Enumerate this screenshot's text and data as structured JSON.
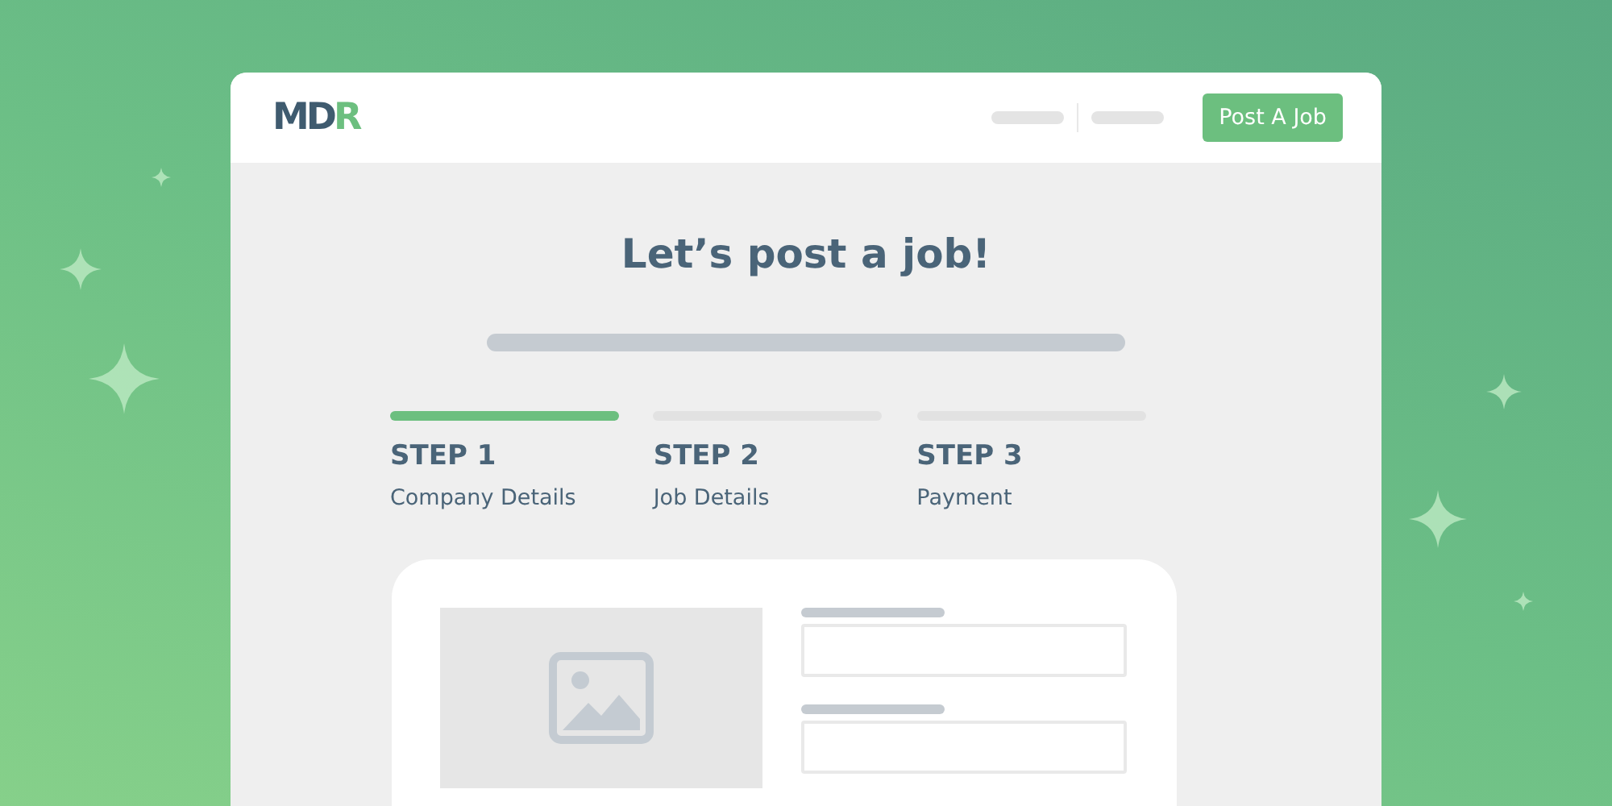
{
  "logo": {
    "text": "MD",
    "accent": "R"
  },
  "header": {
    "button": "Post A Job"
  },
  "title": "Let’s post a job!",
  "steps": [
    {
      "label": "STEP 1",
      "name": "Company Details",
      "selected": true
    },
    {
      "label": "STEP 2",
      "name": "Job Details",
      "selected": false
    },
    {
      "label": "STEP 3",
      "name": "Payment",
      "selected": false
    }
  ],
  "form": {
    "fields": [
      {
        "kind": "input"
      },
      {
        "kind": "input"
      }
    ]
  }
}
